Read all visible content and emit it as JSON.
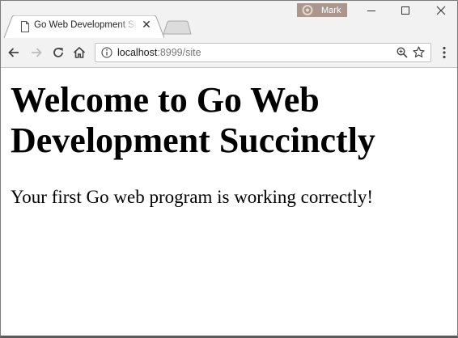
{
  "window": {
    "profile_name": "Mark"
  },
  "tab": {
    "title": "Go Web Development Succinctly",
    "icons": [
      "document-icon",
      "close-icon"
    ]
  },
  "toolbar": {
    "icons": [
      "back-icon",
      "forward-icon",
      "reload-icon",
      "home-icon",
      "info-icon",
      "zoom-icon",
      "star-icon",
      "menu-icon"
    ],
    "url_host": "localhost",
    "url_rest": ":8999/site"
  },
  "page": {
    "heading": "Welcome to Go Web Development Succinctly",
    "message": "Your first Go web program is working correctly!"
  }
}
